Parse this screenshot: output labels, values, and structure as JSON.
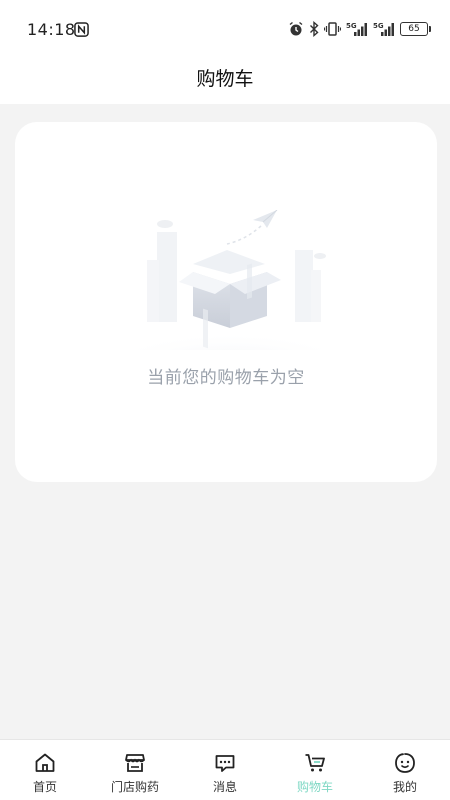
{
  "status_bar": {
    "time": "14:18",
    "battery_level": "65",
    "network_labels": [
      "5G",
      "5G"
    ]
  },
  "header": {
    "title": "购物车"
  },
  "cart": {
    "empty_message": "当前您的购物车为空"
  },
  "tab_bar": {
    "active_color": "#7fd8c4",
    "items": [
      {
        "label": "首页",
        "icon": "home-icon"
      },
      {
        "label": "门店购药",
        "icon": "store-icon"
      },
      {
        "label": "消息",
        "icon": "message-icon"
      },
      {
        "label": "购物车",
        "icon": "cart-icon",
        "active": true
      },
      {
        "label": "我的",
        "icon": "profile-icon"
      }
    ]
  }
}
